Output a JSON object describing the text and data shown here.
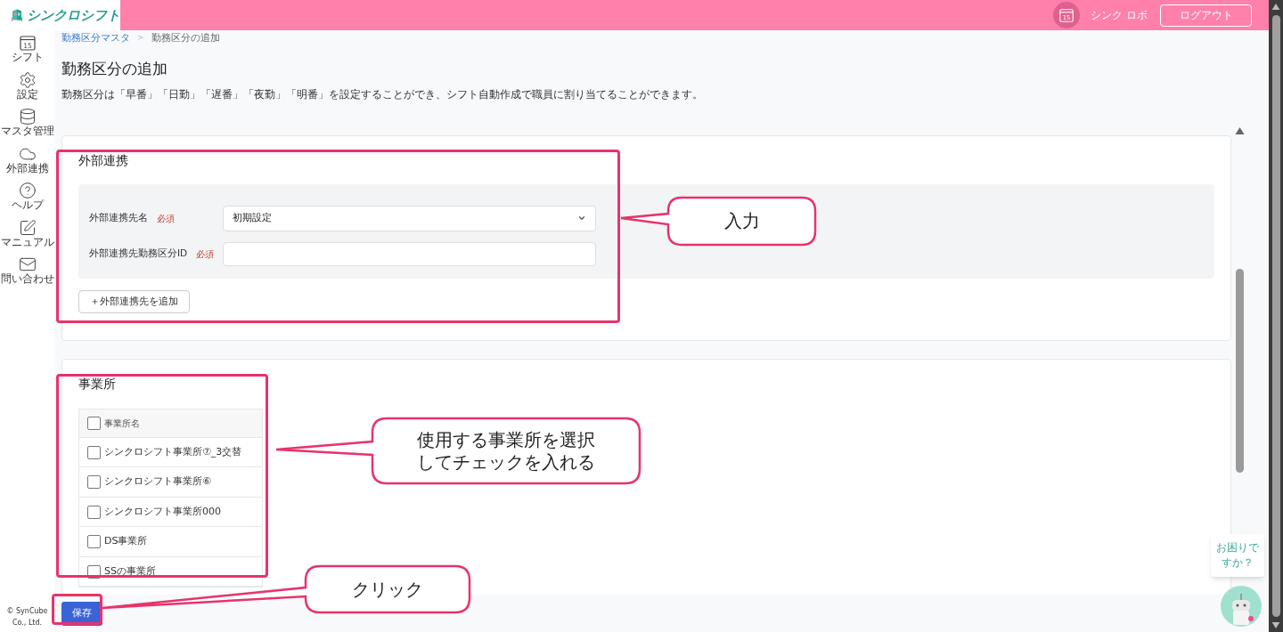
{
  "header": {
    "logo_text": "シンクロシフト",
    "avatar_text": "15",
    "user_name": "シンク ロボ",
    "logout": "ログアウト"
  },
  "sidebar": {
    "items": [
      {
        "kind": "calendar",
        "label": "シフト",
        "icon_text": "15"
      },
      {
        "kind": "gear",
        "label": "設定"
      },
      {
        "kind": "database",
        "label": "マスタ管理"
      },
      {
        "kind": "cloud",
        "label": "外部連携"
      },
      {
        "kind": "help",
        "label": "ヘルプ"
      },
      {
        "kind": "edit",
        "label": "マニュアル"
      },
      {
        "kind": "mail",
        "label": "問い合わせ"
      }
    ],
    "copyright": "© SynCube Co., Ltd."
  },
  "breadcrumb": [
    {
      "label": "勤務区分マスタ",
      "link": true
    },
    {
      "label": "勤務区分の追加",
      "link": false
    }
  ],
  "breadcrumb_separator": ">",
  "title": "勤務区分の追加",
  "description": "勤務区分は「早番」「日勤」「遅番」「夜勤」「明番」を設定することができ、シフト自動作成で職員に割り当てることができます。",
  "external_link": {
    "title": "外部連携",
    "fields": [
      {
        "kind": "select",
        "label": "外部連携先名",
        "required": "必須",
        "value": "初期設定"
      },
      {
        "kind": "text",
        "label": "外部連携先勤務区分ID",
        "required": "必須"
      }
    ],
    "add_button": "＋外部連携先を追加"
  },
  "offices": {
    "title": "事業所",
    "header": {
      "label": "事業所名",
      "checked": false
    },
    "rows": [
      {
        "name": "シンクロシフト事業所⑦_3交替",
        "checked": false
      },
      {
        "name": "シンクロシフト事業所⑥",
        "checked": false
      },
      {
        "name": "シンクロシフト事業所000",
        "checked": false
      },
      {
        "name": "DS事業所",
        "checked": false
      },
      {
        "name": "SSの事業所",
        "checked": false
      }
    ]
  },
  "save_button": "保存",
  "help_bubble": "お困りですか？",
  "annotations": [
    {
      "text": "入力"
    },
    {
      "text": "使用する事業所を選択してチェックを入れる"
    },
    {
      "text": "クリック"
    }
  ]
}
